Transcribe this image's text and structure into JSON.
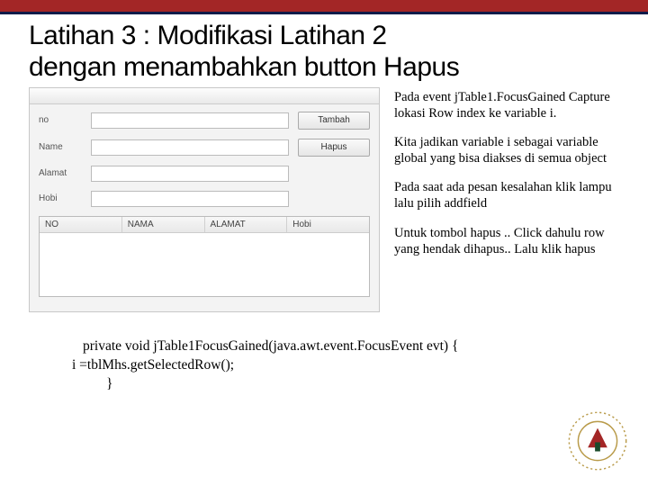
{
  "title_line1": "Latihan 3 : Modifikasi Latihan 2",
  "title_line2": "dengan menambahkan button Hapus",
  "form": {
    "labels": {
      "no": "no",
      "name": "Name",
      "alamat": "Alamat",
      "hobi": "Hobi"
    },
    "buttons": {
      "tambah": "Tambah",
      "hapus": "Hapus"
    }
  },
  "table": {
    "headers": {
      "no": "NO",
      "nama": "NAMA",
      "alamat": "ALAMAT",
      "hobi": "Hobi"
    }
  },
  "explain": {
    "p1": "Pada event  jTable1.FocusGained Capture lokasi Row index ke variable i.",
    "p2": "Kita jadikan variable i sebagai variable global yang bisa diakses di semua object",
    "p3": "Pada saat ada pesan kesalahan klik lampu lalu pilih addfield",
    "p4": "Untuk tombol hapus .. Click dahulu row yang hendak dihapus.. Lalu klik hapus"
  },
  "code": {
    "line1": "private void jTable1FocusGained(java.awt.event.FocusEvent evt) {",
    "line2": "i =tblMhs.getSelectedRow();",
    "line3": "}"
  }
}
